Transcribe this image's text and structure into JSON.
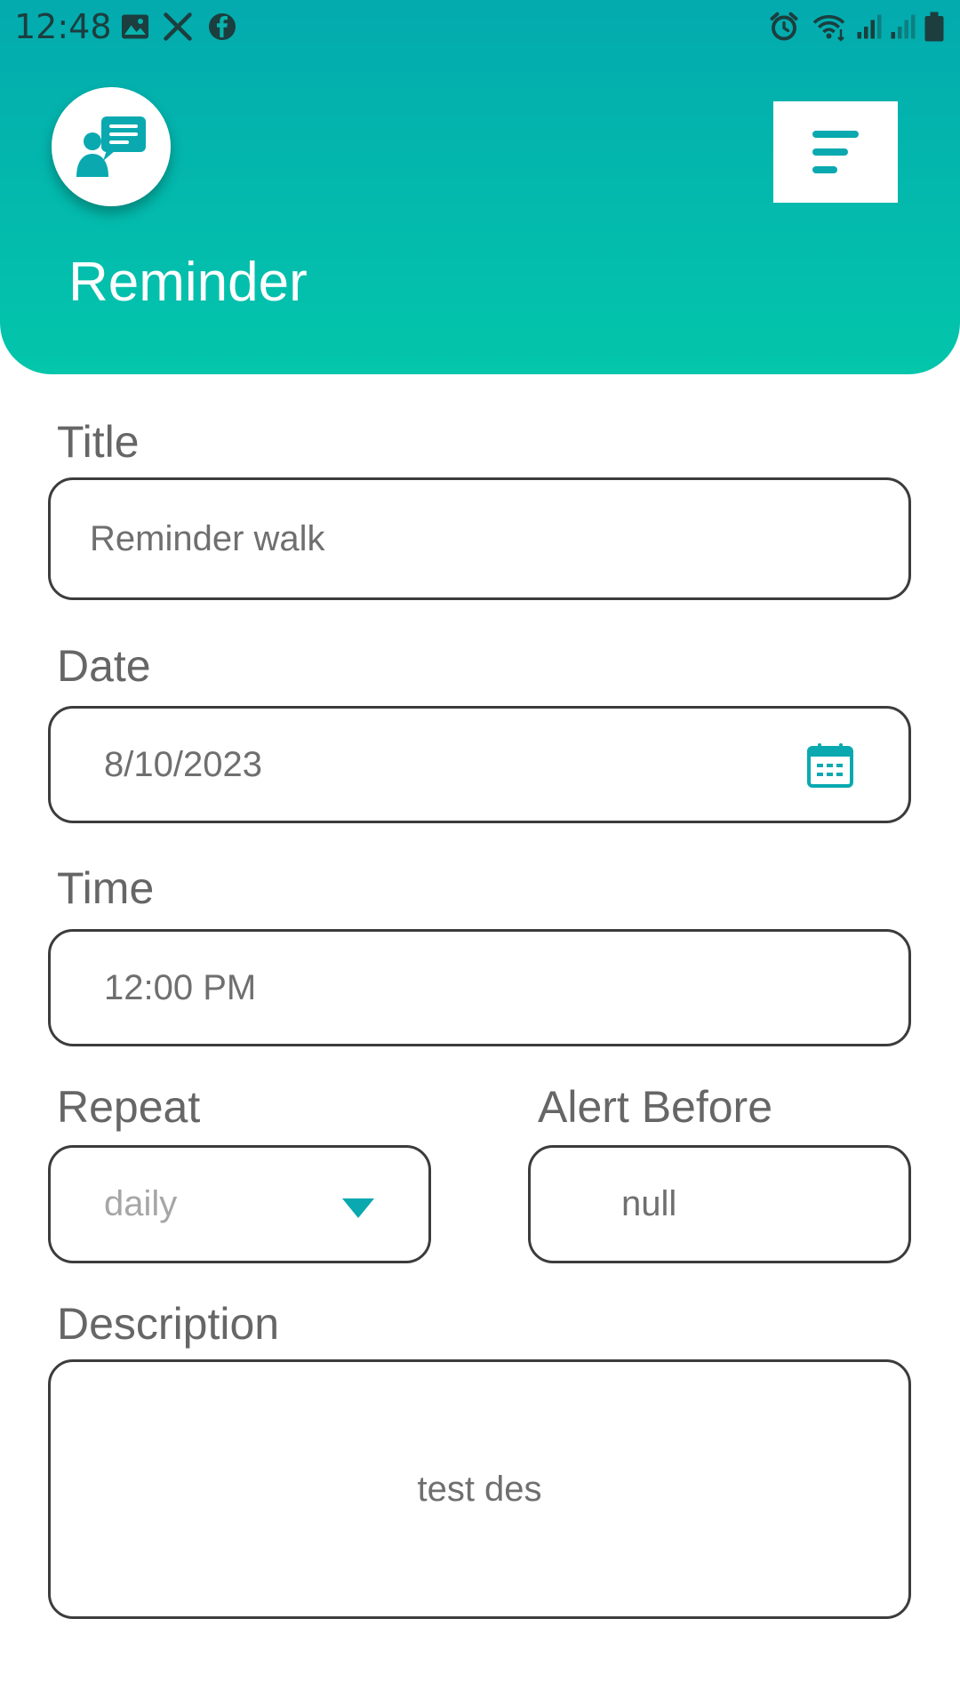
{
  "status_bar": {
    "time": "12:48",
    "icons_left": [
      "image-icon",
      "x-icon",
      "facebook-icon"
    ],
    "icons_right": [
      "alarm-icon",
      "wifi-icon",
      "signal-icon",
      "signal-icon",
      "battery-icon"
    ]
  },
  "header": {
    "logo_icon": "chat-user-icon",
    "menu_icon": "sort-menu-icon",
    "title": "Reminder"
  },
  "form": {
    "title": {
      "label": "Title",
      "value": "Reminder walk"
    },
    "date": {
      "label": "Date",
      "value": "8/10/2023",
      "icon": "calendar-icon"
    },
    "time": {
      "label": "Time",
      "value": "12:00 PM"
    },
    "repeat": {
      "label": "Repeat",
      "value": "daily",
      "icon": "dropdown-triangle-icon"
    },
    "alert_before": {
      "label": "Alert Before",
      "value": "null"
    },
    "description": {
      "label": "Description",
      "value": "test des"
    }
  },
  "colors": {
    "header_top": "#03aaae",
    "header_bottom": "#03c6ab",
    "accent": "#0aa9b0",
    "border": "#3c3c3c"
  }
}
